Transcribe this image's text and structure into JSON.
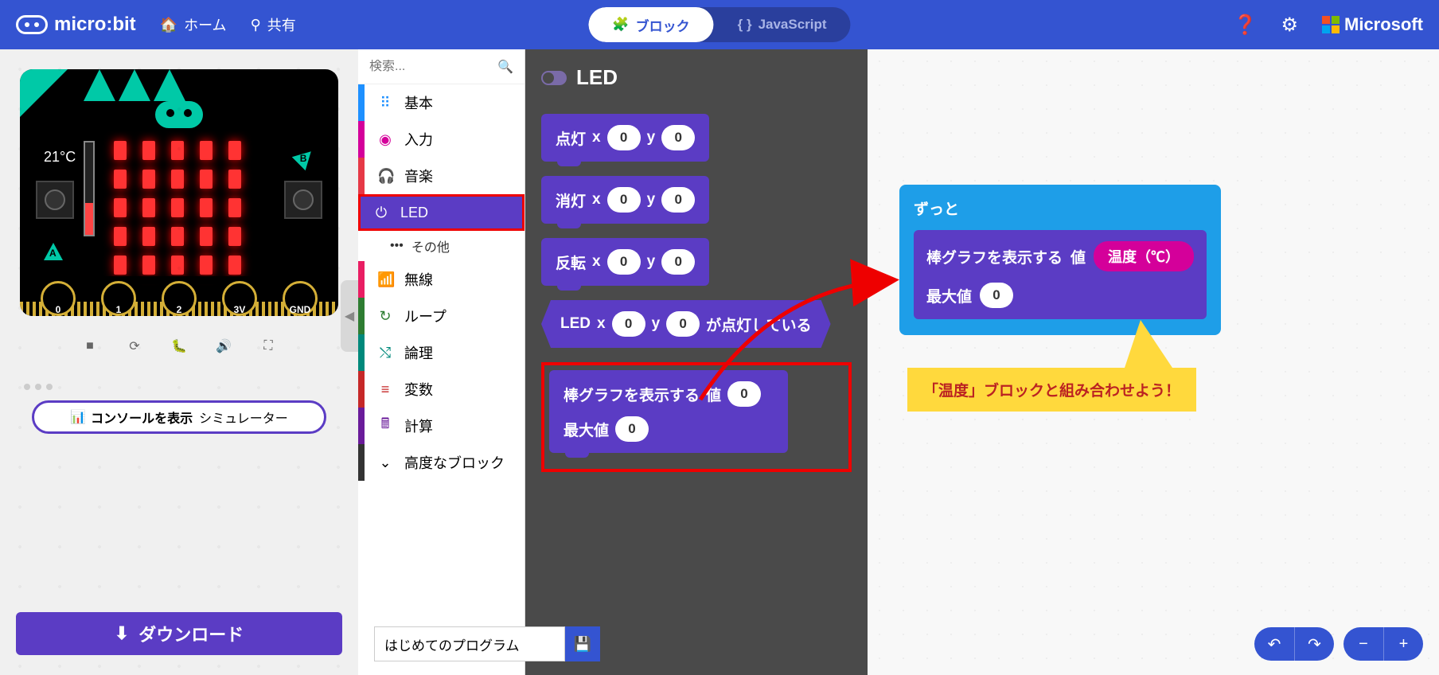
{
  "header": {
    "logo_text": "micro:bit",
    "home": "ホーム",
    "share": "共有",
    "toggle_blocks": "ブロック",
    "toggle_js": "JavaScript",
    "ms_label": "Microsoft"
  },
  "sim": {
    "temp": "21°C",
    "pin_labels": [
      "0",
      "1",
      "2",
      "3V",
      "GND"
    ],
    "console_bold": "コンソールを表示",
    "console_rest": "シミュレーター",
    "download": "ダウンロード"
  },
  "toolbox": {
    "search_placeholder": "検索...",
    "categories": [
      {
        "label": "基本",
        "color": "#1e90ff",
        "icon": "⠿"
      },
      {
        "label": "入力",
        "color": "#d4009a",
        "icon": "◉"
      },
      {
        "label": "音楽",
        "color": "#e63946",
        "icon": "🎧"
      },
      {
        "label": "LED",
        "color": "#5b3cc4",
        "icon": "⏻",
        "selected": true
      },
      {
        "label": "無線",
        "color": "#e91e63",
        "icon": "📶"
      },
      {
        "label": "ループ",
        "color": "#2e7d32",
        "icon": "↻"
      },
      {
        "label": "論理",
        "color": "#00897b",
        "icon": "⤭"
      },
      {
        "label": "変数",
        "color": "#c62828",
        "icon": "≡"
      },
      {
        "label": "計算",
        "color": "#6a1b9a",
        "icon": "🖩"
      }
    ],
    "sub_other": "その他",
    "advanced": "高度なブロック"
  },
  "flyout": {
    "title": "LED",
    "blocks": {
      "plot": {
        "label": "点灯",
        "x": "x",
        "xv": "0",
        "y": "y",
        "yv": "0"
      },
      "unplot": {
        "label": "消灯",
        "x": "x",
        "xv": "0",
        "y": "y",
        "yv": "0"
      },
      "toggle": {
        "label": "反転",
        "x": "x",
        "xv": "0",
        "y": "y",
        "yv": "0"
      },
      "point": {
        "prefix": "LED",
        "x": "x",
        "xv": "0",
        "y": "y",
        "yv": "0",
        "suffix": "が点灯している"
      },
      "bargraph": {
        "line1": "棒グラフを表示する",
        "val_label": "値",
        "val": "0",
        "max_label": "最大値",
        "max": "0"
      }
    }
  },
  "workspace": {
    "forever_label": "ずっと",
    "bargraph_label": "棒グラフを表示する",
    "val_label": "値",
    "temp_label": "温度（℃）",
    "max_label": "最大値",
    "max_val": "0",
    "annotation": "「温度」ブロックと組み合わせよう！"
  },
  "bottom": {
    "project_name": "はじめてのプログラム"
  }
}
